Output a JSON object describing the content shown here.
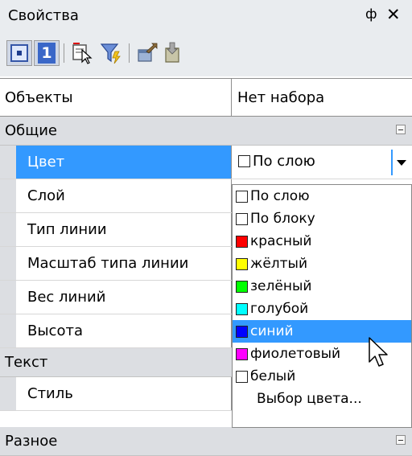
{
  "panel": {
    "title": "Свойства",
    "pin_glyph": "ф",
    "close_glyph": "✕"
  },
  "toolbar": {
    "buttons": [
      {
        "name": "pickadd-toggle-icon",
        "pressed": true
      },
      {
        "name": "single-select-icon",
        "label": "1",
        "pressed": true
      },
      {
        "name": "select-objects-icon"
      },
      {
        "name": "quick-select-filter-icon"
      },
      {
        "name": "export-icon"
      },
      {
        "name": "import-icon"
      }
    ]
  },
  "header": {
    "objects_label": "Объекты",
    "selection_value": "Нет набора"
  },
  "categories": {
    "general": "Общие",
    "text": "Текст",
    "misc": "Разное"
  },
  "properties": {
    "color": "Цвет",
    "layer": "Слой",
    "linetype": "Тип линии",
    "linetype_scale": "Масштаб типа линии",
    "lineweight": "Вес линий",
    "height": "Высота",
    "style": "Стиль"
  },
  "color_combo": {
    "current_value": "По слою"
  },
  "color_options": [
    {
      "label": "По слою",
      "swatch": "#ffffff"
    },
    {
      "label": "По блоку",
      "swatch": "#ffffff"
    },
    {
      "label": "красный",
      "swatch": "#ff0000"
    },
    {
      "label": "жёлтый",
      "swatch": "#ffff00"
    },
    {
      "label": "зелёный",
      "swatch": "#00ff00"
    },
    {
      "label": "голубой",
      "swatch": "#00ffff"
    },
    {
      "label": "синий",
      "swatch": "#0000ff",
      "highlighted": true
    },
    {
      "label": "фиолетовый",
      "swatch": "#ff00ff"
    },
    {
      "label": "белый",
      "swatch": "#ffffff"
    },
    {
      "label": "Выбор цвета..."
    }
  ],
  "colors": {
    "selection_blue": "#3399ff",
    "category_gray": "#dcdee2",
    "titlebar_gray": "#e9ecef"
  }
}
